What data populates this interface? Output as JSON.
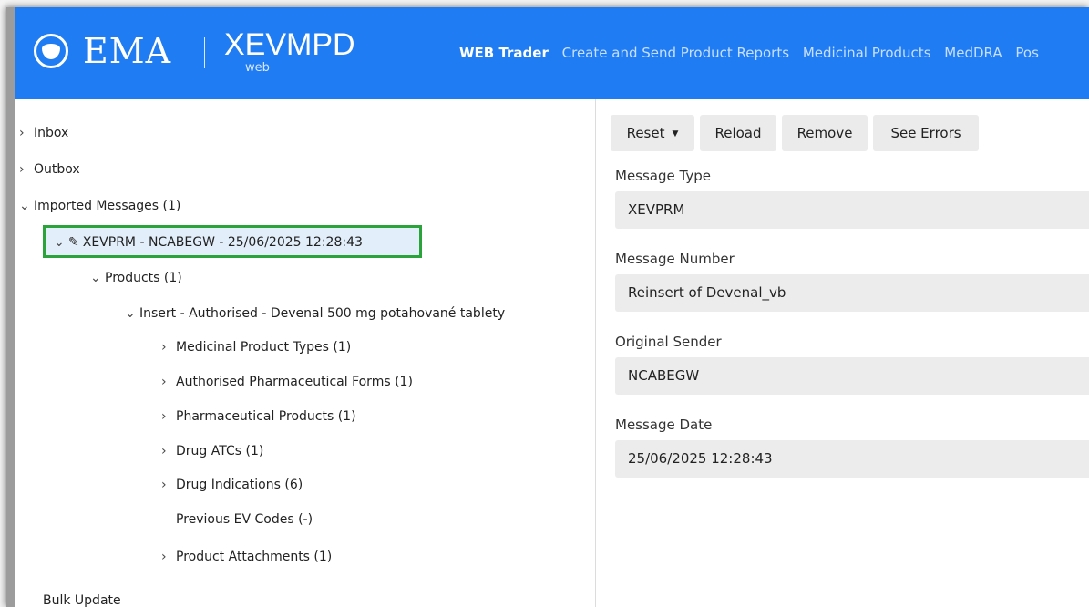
{
  "header": {
    "logo_text": "EMA",
    "app_name": "XEVMPD",
    "app_sub": "web",
    "nav": [
      {
        "label": "WEB Trader",
        "active": true
      },
      {
        "label": "Create and Send Product Reports",
        "active": false
      },
      {
        "label": "Medicinal Products",
        "active": false
      },
      {
        "label": "MedDRA",
        "active": false
      },
      {
        "label": "Pos",
        "active": false
      }
    ]
  },
  "tree": {
    "inbox": "Inbox",
    "outbox": "Outbox",
    "imported": "Imported Messages (1)",
    "message": "XEVPRM - NCABEGW - 25/06/2025 12:28:43",
    "products": "Products (1)",
    "insert": "Insert - Authorised - Devenal 500 mg potahované tablety",
    "medicinal_product_types": "Medicinal Product Types (1)",
    "authorised_forms": "Authorised Pharmaceutical Forms (1)",
    "pharma_products": "Pharmaceutical Products (1)",
    "drug_atcs": "Drug ATCs (1)",
    "drug_indications": "Drug Indications (6)",
    "previous_ev_codes": "Previous EV Codes (-)",
    "product_attachments": "Product Attachments (1)",
    "bulk_update": "Bulk Update"
  },
  "toolbar": {
    "reset": "Reset",
    "reload": "Reload",
    "remove": "Remove",
    "see_errors": "See Errors"
  },
  "details": {
    "message_type_label": "Message Type",
    "message_type_value": "XEVPRM",
    "message_number_label": "Message Number",
    "message_number_value": "Reinsert of Devenal_vb",
    "original_sender_label": "Original Sender",
    "original_sender_value": "NCABEGW",
    "message_date_label": "Message Date",
    "message_date_value": "25/06/2025 12:28:43"
  },
  "colors": {
    "header_bg": "#1f7cf3",
    "selection_border": "#2aa33a"
  }
}
